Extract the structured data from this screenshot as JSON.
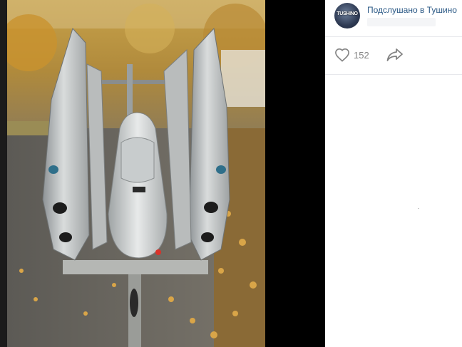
{
  "post": {
    "group_name": "Подслушано в Тушино",
    "avatar_text": "TUSHINO",
    "likes": "152"
  },
  "icons": {
    "like": "heart-icon",
    "share": "share-arrow-icon"
  },
  "colors": {
    "link": "#2a5885",
    "muted": "#828282",
    "divider": "#e7e8ec",
    "backdrop": "#000000"
  }
}
